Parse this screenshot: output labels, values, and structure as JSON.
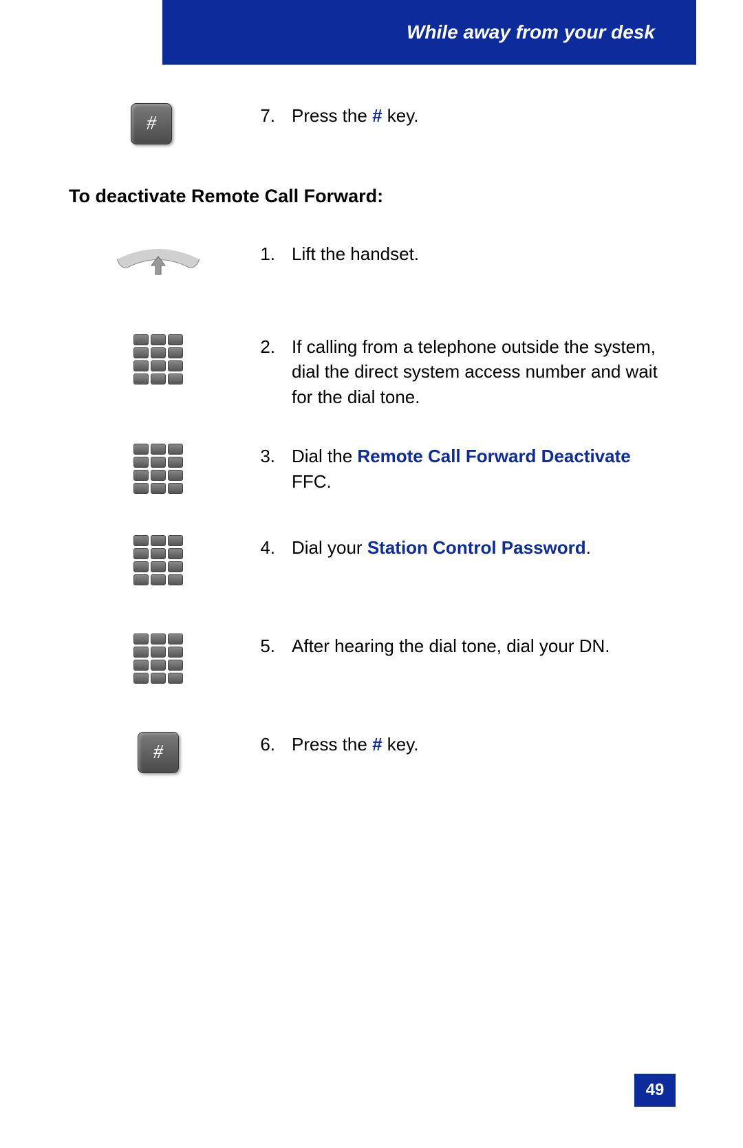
{
  "header": {
    "title": "While away from your desk"
  },
  "pre_step": {
    "num": "7.",
    "text_before": "Press the ",
    "hash": "#",
    "text_after": " key."
  },
  "section_heading": "To deactivate Remote Call Forward:",
  "steps": [
    {
      "num": "1.",
      "parts": [
        {
          "text": "Lift the handset.",
          "highlight": false
        }
      ]
    },
    {
      "num": "2.",
      "parts": [
        {
          "text": "If calling from a telephone outside the system, dial the direct system access number and wait for the dial tone.",
          "highlight": false
        }
      ]
    },
    {
      "num": "3.",
      "parts": [
        {
          "text": "Dial the ",
          "highlight": false
        },
        {
          "text": "Remote Call Forward Deactivate",
          "highlight": true
        },
        {
          "text": " FFC.",
          "highlight": false
        }
      ]
    },
    {
      "num": "4.",
      "parts": [
        {
          "text": "Dial your ",
          "highlight": false
        },
        {
          "text": "Station Control Password",
          "highlight": true
        },
        {
          "text": ".",
          "highlight": false
        }
      ]
    },
    {
      "num": "5.",
      "parts": [
        {
          "text": "After hearing the dial tone, dial your DN.",
          "highlight": false
        }
      ]
    },
    {
      "num": "6.",
      "parts": [
        {
          "text": "Press the ",
          "highlight": false
        },
        {
          "text": "#",
          "highlight": true
        },
        {
          "text": " key.",
          "highlight": false
        }
      ]
    }
  ],
  "page_number": "49",
  "icons": {
    "hash": "#"
  }
}
